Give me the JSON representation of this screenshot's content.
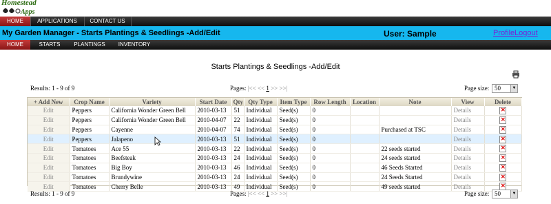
{
  "logo": {
    "line1": "Homestead",
    "line2": "Apps"
  },
  "top_nav": [
    {
      "label": "HOME",
      "active": true
    },
    {
      "label": "APPLICATIONS",
      "active": false
    },
    {
      "label": "CONTACT US",
      "active": false
    }
  ],
  "header": {
    "app_title": "My Garden Manager - Starts Plantings & Seedlings -Add/Edit",
    "user_label": "User: Sample",
    "profile_link": "Profile",
    "logout_link": "Logout"
  },
  "sub_nav": [
    {
      "label": "HOME",
      "active": true
    },
    {
      "label": "STARTS",
      "active": false
    },
    {
      "label": "PLANTINGS",
      "active": false
    },
    {
      "label": "INVENTORY",
      "active": false
    }
  ],
  "page": {
    "heading": "Starts Plantings & Seedlings -Add/Edit",
    "print_icon": "printer-icon"
  },
  "pager": {
    "results": "Results: 1 - 9 of 9",
    "pages_label": "Pages:",
    "first": "|<<",
    "prev": "<<",
    "current": "1",
    "next": ">>",
    "last": ">>|",
    "page_size_label": "Page size:",
    "page_size_value": "50"
  },
  "table": {
    "add_new": "+ Add New",
    "columns": [
      "Crop Name",
      "Variety",
      "Start Date",
      "Qty",
      "Qty Type",
      "Item Type",
      "Row Length",
      "Location",
      "Note",
      "View",
      "Delete"
    ],
    "edit_label": "Edit",
    "details_label": "Details",
    "rows": [
      {
        "crop": "Peppers",
        "variety": "California Wonder Green Bell",
        "date": "2010-03-13",
        "qty": "51",
        "qty_type": "Individual",
        "item_type": "Seed(s)",
        "row_length": "0",
        "location": "",
        "note": ""
      },
      {
        "crop": "Peppers",
        "variety": "California Wonder Green Bell",
        "date": "2010-04-07",
        "qty": "22",
        "qty_type": "Individual",
        "item_type": "Seed(s)",
        "row_length": "0",
        "location": "",
        "note": ""
      },
      {
        "crop": "Peppers",
        "variety": "Cayenne",
        "date": "2010-04-07",
        "qty": "74",
        "qty_type": "Individual",
        "item_type": "Seed(s)",
        "row_length": "0",
        "location": "",
        "note": "Purchased at TSC"
      },
      {
        "crop": "Peppers",
        "variety": "Jalapeno",
        "date": "2010-03-13",
        "qty": "51",
        "qty_type": "Individual",
        "item_type": "Seed(s)",
        "row_length": "0",
        "location": "",
        "note": "",
        "highlight": true
      },
      {
        "crop": "Tomatoes",
        "variety": "Ace 55",
        "date": "2010-03-13",
        "qty": "22",
        "qty_type": "Individual",
        "item_type": "Seed(s)",
        "row_length": "0",
        "location": "",
        "note": "22 seeds started"
      },
      {
        "crop": "Tomatoes",
        "variety": "Beefsteak",
        "date": "2010-03-13",
        "qty": "24",
        "qty_type": "Individual",
        "item_type": "Seed(s)",
        "row_length": "0",
        "location": "",
        "note": "24 seeds started"
      },
      {
        "crop": "Tomatoes",
        "variety": "Big Boy",
        "date": "2010-03-13",
        "qty": "46",
        "qty_type": "Individual",
        "item_type": "Seed(s)",
        "row_length": "0",
        "location": "",
        "note": "46 Seeds Started"
      },
      {
        "crop": "Tomatoes",
        "variety": "Brundywine",
        "date": "2010-03-13",
        "qty": "24",
        "qty_type": "Individual",
        "item_type": "Seed(s)",
        "row_length": "0",
        "location": "",
        "note": "24 Seeds Started"
      },
      {
        "crop": "Tomatoes",
        "variety": "Cherry Belle",
        "date": "2010-03-13",
        "qty": "49",
        "qty_type": "Individual",
        "item_type": "Seed(s)",
        "row_length": "0",
        "location": "",
        "note": "49 seeds started"
      }
    ]
  },
  "colors": {
    "accent_blue": "#16b7ee",
    "nav_active_red": "#b02a2a",
    "link_purple": "#7b1fd6"
  }
}
